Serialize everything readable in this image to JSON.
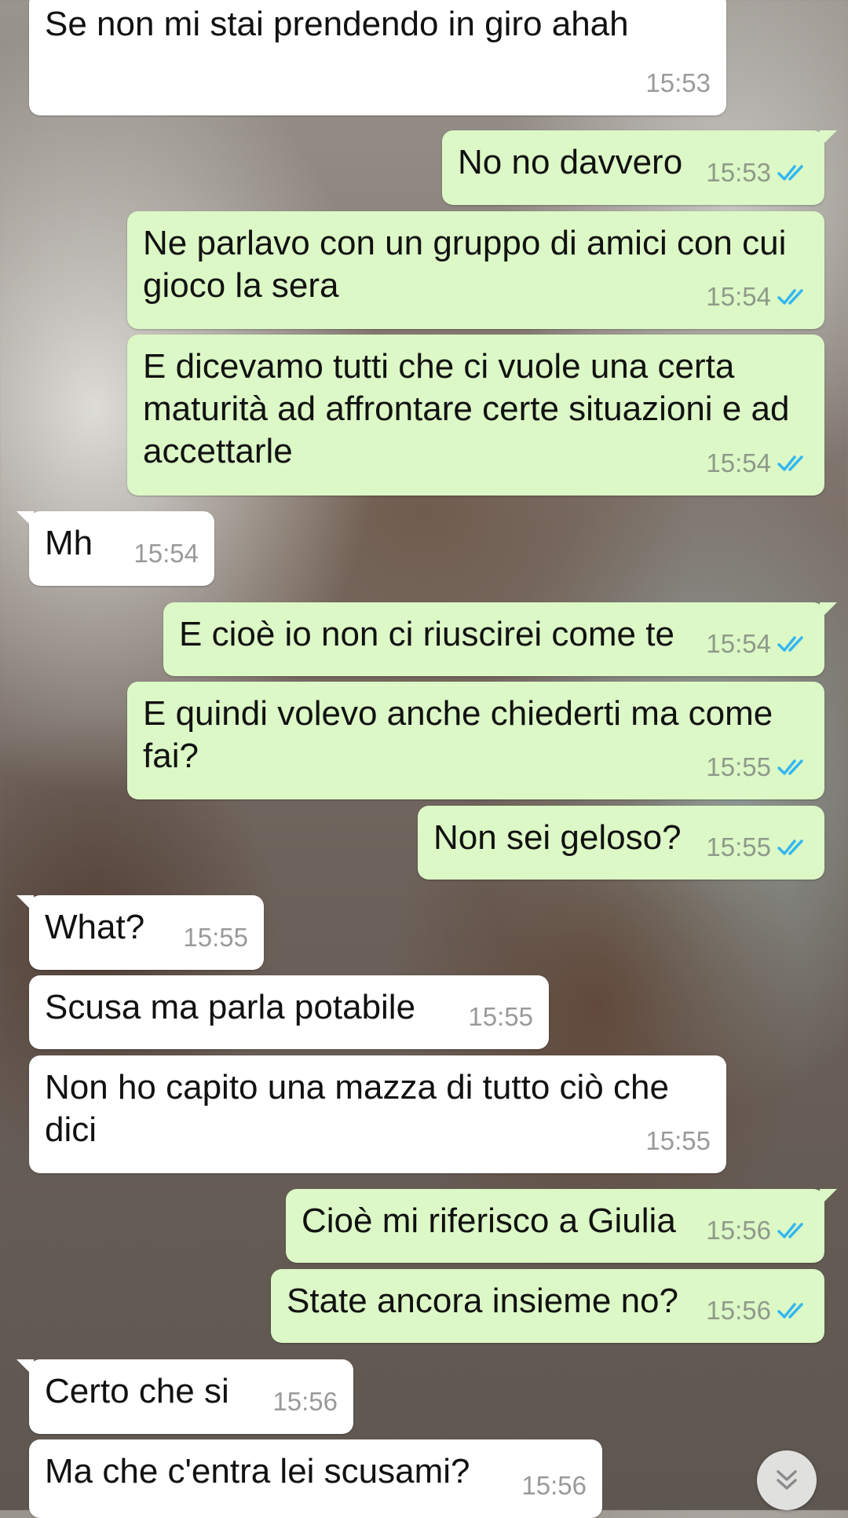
{
  "messages": [
    {
      "dir": "in",
      "text": "Se non mi stai prendendo in giro ahah",
      "time": "15:53",
      "tail": false
    },
    {
      "dir": "out",
      "text": "No no davvero",
      "time": "15:53",
      "tail": true
    },
    {
      "dir": "out",
      "text": "Ne parlavo con un gruppo di amici con cui gioco la sera",
      "time": "15:54",
      "tail": false
    },
    {
      "dir": "out",
      "text": "E dicevamo tutti che ci vuole una certa maturità ad affrontare certe situazioni e ad accettarle",
      "time": "15:54",
      "tail": false
    },
    {
      "dir": "in",
      "text": "Mh",
      "time": "15:54",
      "tail": true
    },
    {
      "dir": "out",
      "text": "E cioè io non ci riuscirei come te",
      "time": "15:54",
      "tail": true
    },
    {
      "dir": "out",
      "text": "E quindi volevo anche chiederti ma come fai?",
      "time": "15:55",
      "tail": false
    },
    {
      "dir": "out",
      "text": "Non sei geloso?",
      "time": "15:55",
      "tail": false
    },
    {
      "dir": "in",
      "text": "What?",
      "time": "15:55",
      "tail": true
    },
    {
      "dir": "in",
      "text": "Scusa ma parla potabile",
      "time": "15:55",
      "tail": false
    },
    {
      "dir": "in",
      "text": "Non ho capito una mazza di tutto ciò che dici",
      "time": "15:55",
      "tail": false
    },
    {
      "dir": "out",
      "text": "Cioè mi riferisco a Giulia",
      "time": "15:56",
      "tail": true
    },
    {
      "dir": "out",
      "text": "State ancora insieme no?",
      "time": "15:56",
      "tail": false
    },
    {
      "dir": "in",
      "text": "Certo che si",
      "time": "15:56",
      "tail": true
    },
    {
      "dir": "in",
      "text": "Ma che c'entra lei scusami?",
      "time": "15:56",
      "tail": false
    }
  ],
  "icons": {
    "read_receipt": "double-check-icon",
    "scroll_down": "double-chevron-down-icon"
  },
  "colors": {
    "incoming_bubble": "#ffffff",
    "outgoing_bubble": "#dcf8c6",
    "read_tick": "#34b7f1",
    "timestamp": "#9a9a9a"
  }
}
